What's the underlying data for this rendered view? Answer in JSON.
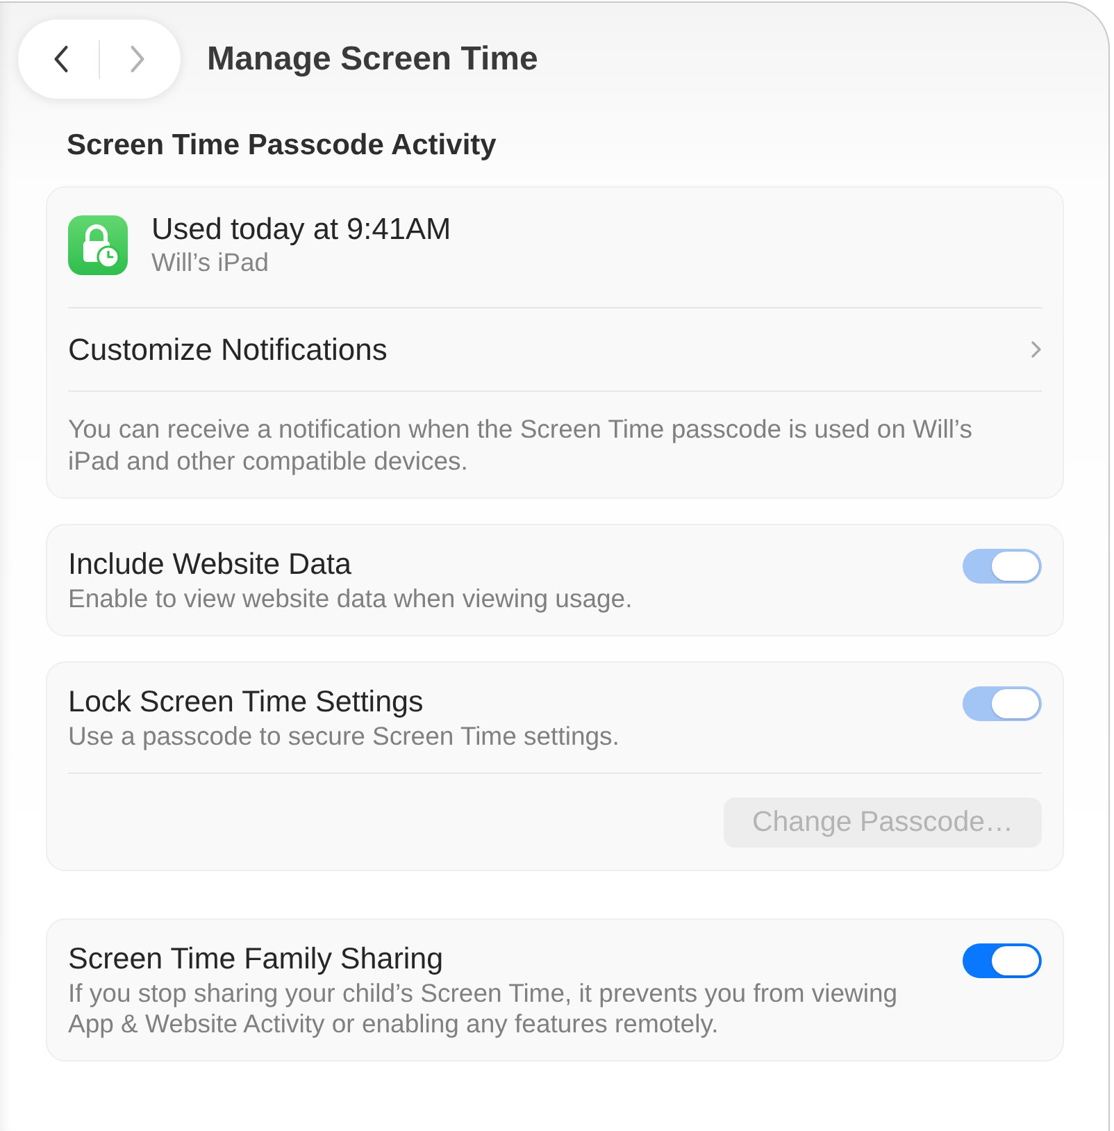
{
  "window": {
    "title": "Manage Screen Time"
  },
  "nav_buttons": [
    {
      "kind": "back",
      "disabled": false
    },
    {
      "kind": "forward",
      "disabled": true
    }
  ],
  "passcode_activity": {
    "heading": "Screen Time Passcode Activity",
    "last_use": {
      "title": "Used today at 9:41AM",
      "device": "Will’s iPad"
    },
    "link_row": {
      "label": "Customize Notifications"
    },
    "footnote": "You can receive a notification when the Screen Time passcode is used on Will’s iPad and other compatible devices."
  },
  "groups": [
    {
      "cards": [
        {
          "kind": "toggle",
          "title": "Include Website Data",
          "description": "Enable to view website data when viewing usage.",
          "toggle": {
            "on": true,
            "disabled": true
          }
        },
        {
          "kind": "toggle_button",
          "title": "Lock Screen Time Settings",
          "description": "Use a passcode to secure Screen Time settings.",
          "toggle": {
            "on": true,
            "disabled": true
          },
          "button": {
            "label": "Change Passcode…",
            "disabled": true
          }
        }
      ]
    },
    {
      "cards": [
        {
          "kind": "toggle",
          "title": "Screen Time Family Sharing",
          "description": "If you stop sharing your child’s Screen Time, it prevents you from viewing App & Website Activity or enabling any features remotely.",
          "toggle": {
            "on": true,
            "disabled": false
          }
        }
      ]
    }
  ]
}
